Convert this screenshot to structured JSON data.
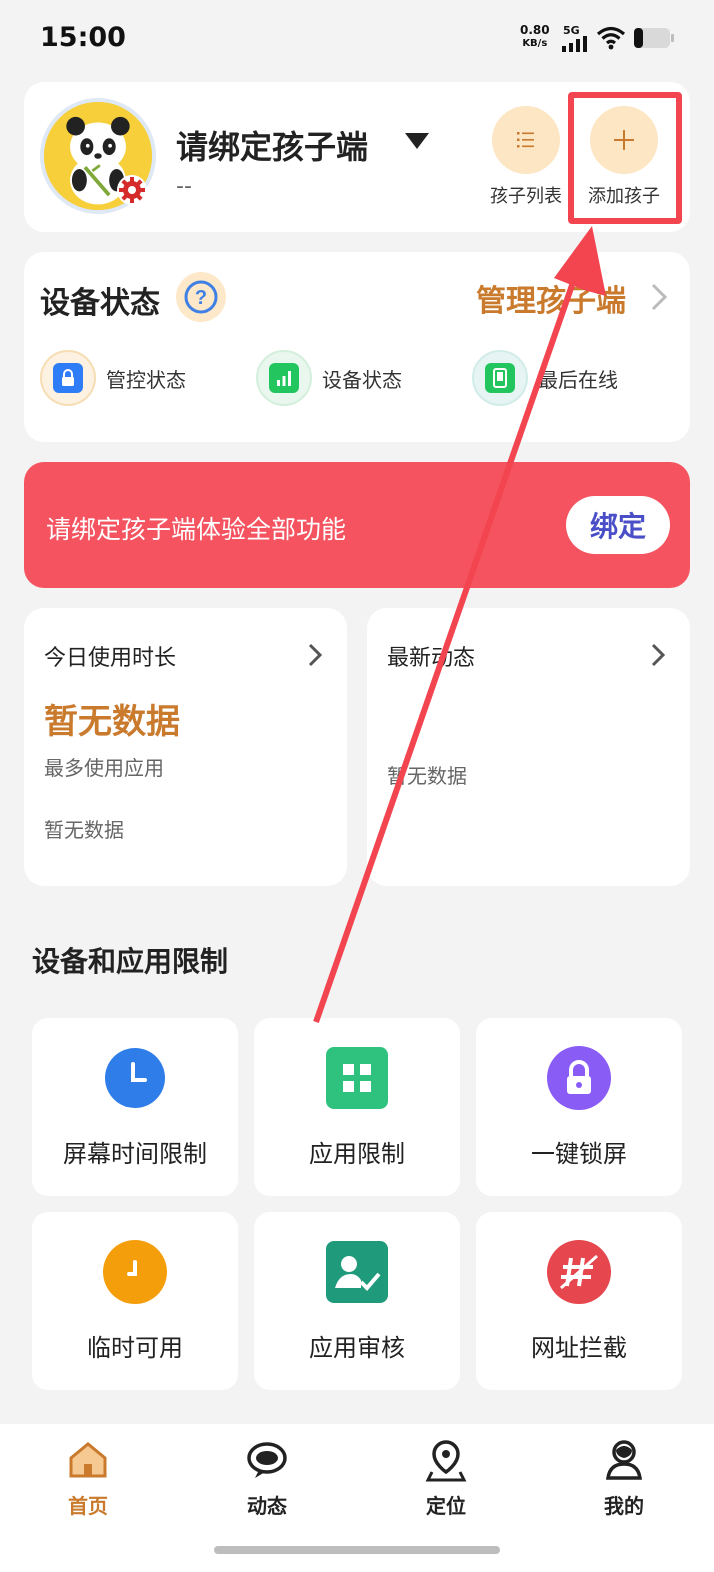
{
  "status_bar": {
    "time": "15:00",
    "net_speed_value": "0.80",
    "net_speed_unit": "KB/s",
    "network": "5G"
  },
  "profile": {
    "name": "请绑定孩子端",
    "sub": "--",
    "actions": [
      {
        "label": "孩子列表",
        "icon": "list-icon"
      },
      {
        "label": "添加孩子",
        "icon": "plus-icon"
      }
    ]
  },
  "device_status": {
    "title": "设备状态",
    "manage_link": "管理孩子端",
    "items": [
      {
        "label": "管控状态",
        "icon": "lock-icon",
        "color": "#2f7df6"
      },
      {
        "label": "设备状态",
        "icon": "signal-chart-icon",
        "color": "#22c55e"
      },
      {
        "label": "最后在线",
        "icon": "tablet-icon",
        "color": "#22c55e"
      }
    ]
  },
  "bind_banner": {
    "text": "请绑定孩子端体验全部功能",
    "button": "绑定"
  },
  "usage_card": {
    "title": "今日使用时长",
    "value": "暂无数据",
    "sub_title": "最多使用应用",
    "empty": "暂无数据"
  },
  "news_card": {
    "title": "最新动态",
    "empty": "暂无数据"
  },
  "section_title": "设备和应用限制",
  "tiles": [
    {
      "label": "屏幕时间限制",
      "icon": "clock-icon",
      "color": "#2f7de8"
    },
    {
      "label": "应用限制",
      "icon": "apps-grid-icon",
      "color": "#2ec27e"
    },
    {
      "label": "一键锁屏",
      "icon": "padlock-icon",
      "color": "#8a5cf6"
    },
    {
      "label": "临时可用",
      "icon": "timer-icon",
      "color": "#f59e0b"
    },
    {
      "label": "应用审核",
      "icon": "user-check-icon",
      "color": "#1f9a7a"
    },
    {
      "label": "网址拦截",
      "icon": "block-url-icon",
      "color": "#e6474f"
    }
  ],
  "bottom_nav": [
    {
      "label": "首页",
      "icon": "home-icon",
      "active": true
    },
    {
      "label": "动态",
      "icon": "chat-icon",
      "active": false
    },
    {
      "label": "定位",
      "icon": "location-icon",
      "active": false
    },
    {
      "label": "我的",
      "icon": "profile-icon",
      "active": false
    }
  ],
  "colors": {
    "accent": "#c97a2c",
    "banner": "#f4535f",
    "annotation": "#f2454f"
  }
}
